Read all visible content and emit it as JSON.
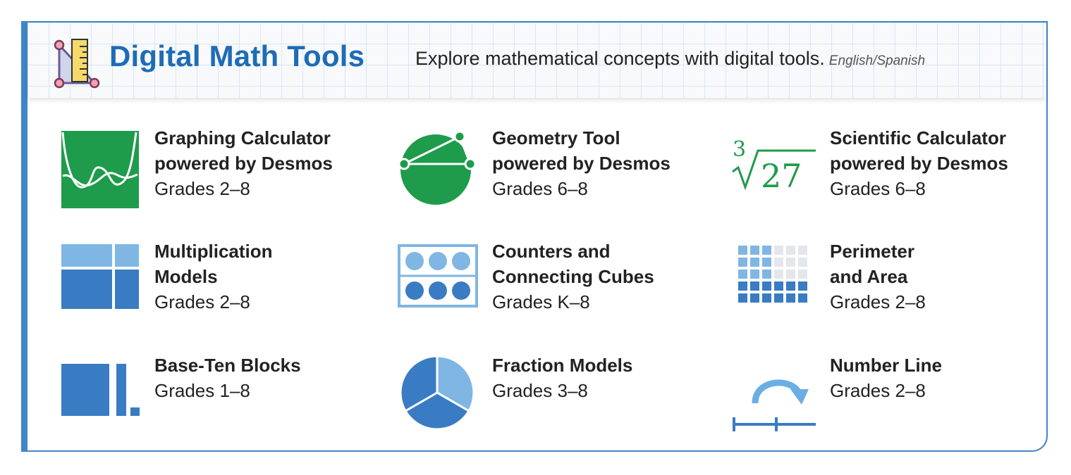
{
  "header": {
    "title": "Digital Math Tools",
    "subtitle": "Explore mathematical concepts with digital tools.",
    "language": "English/Spanish",
    "icon": "triangle-ruler-icon"
  },
  "colors": {
    "accent_blue": "#3f86c8",
    "title_blue": "#1e6cb5",
    "desmos_green": "#1e9b4b",
    "light_blue": "#7fb6e3",
    "dark_blue": "#3a7cc3"
  },
  "tools": [
    {
      "name_line1": "Graphing Calculator",
      "name_line2": "powered by Desmos",
      "grades": "Grades 2–8",
      "icon": "graphing-calculator-icon"
    },
    {
      "name_line1": "Geometry Tool",
      "name_line2": "powered by Desmos",
      "grades": "Grades 6–8",
      "icon": "geometry-tool-icon"
    },
    {
      "name_line1": "Scientific Calculator",
      "name_line2": "powered by Desmos",
      "grades": "Grades 6–8",
      "icon": "scientific-calculator-icon",
      "icon_index": "3",
      "icon_radicand": "27"
    },
    {
      "name_line1": "Multiplication",
      "name_line2": "Models",
      "grades": "Grades 2–8",
      "icon": "multiplication-models-icon"
    },
    {
      "name_line1": "Counters and",
      "name_line2": "Connecting Cubes",
      "grades": "Grades K–8",
      "icon": "counters-icon"
    },
    {
      "name_line1": "Perimeter",
      "name_line2": "and Area",
      "grades": "Grades 2–8",
      "icon": "perimeter-area-icon"
    },
    {
      "name_line1": "Base-Ten Blocks",
      "name_line2": "",
      "grades": "Grades 1–8",
      "icon": "base-ten-blocks-icon"
    },
    {
      "name_line1": "Fraction Models",
      "name_line2": "",
      "grades": "Grades 3–8",
      "icon": "fraction-models-icon"
    },
    {
      "name_line1": "Number Line",
      "name_line2": "",
      "grades": "Grades 2–8",
      "icon": "number-line-icon"
    }
  ]
}
